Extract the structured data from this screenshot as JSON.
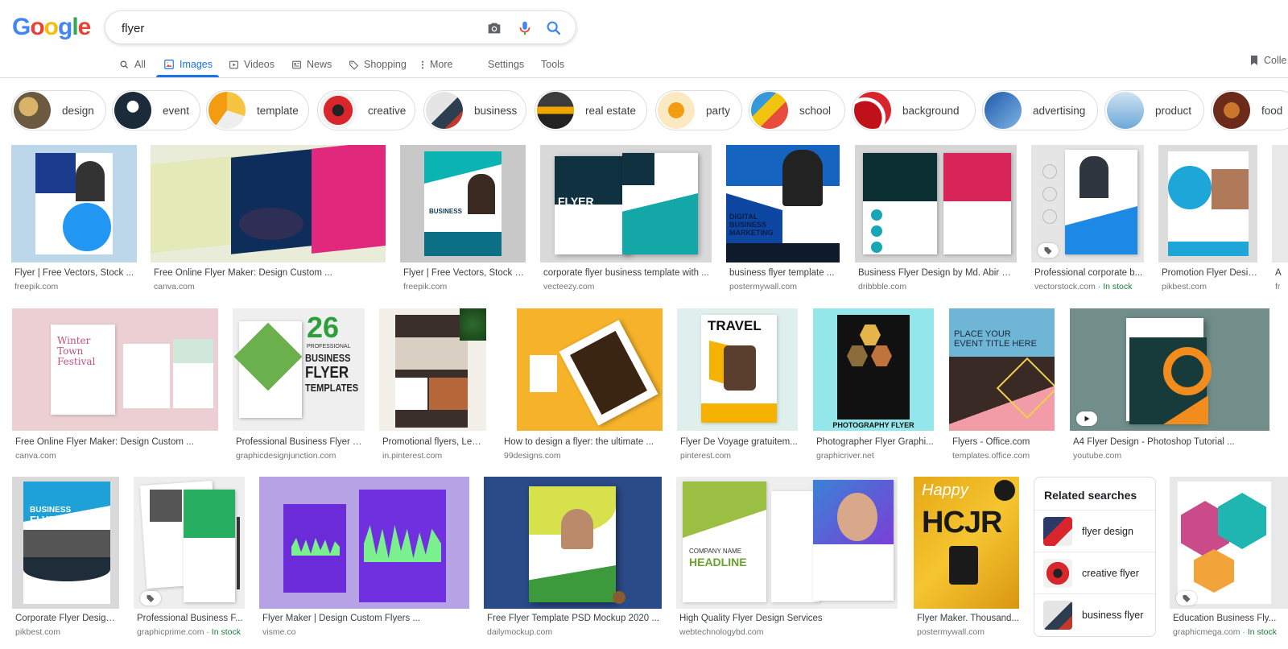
{
  "logo": {
    "letters": [
      "G",
      "o",
      "o",
      "g",
      "l",
      "e"
    ],
    "colors": [
      "#4285F4",
      "#EA4335",
      "#FBBC05",
      "#4285F4",
      "#34A853",
      "#EA4335"
    ]
  },
  "search": {
    "query": "flyer"
  },
  "nav": {
    "items": [
      "All",
      "Images",
      "Videos",
      "News",
      "Shopping",
      "More"
    ],
    "settings": "Settings",
    "tools": "Tools",
    "collections": "Colle"
  },
  "chips": [
    "design",
    "event",
    "template",
    "creative",
    "business",
    "real estate",
    "party",
    "school",
    "background",
    "advertising",
    "product",
    "food"
  ],
  "results": [
    {
      "title": "Flyer | Free Vectors, Stock ...",
      "source": "freepik.com",
      "stock": ""
    },
    {
      "title": "Free Online Flyer Maker: Design Custom ...",
      "source": "canva.com",
      "stock": ""
    },
    {
      "title": "Flyer | Free Vectors, Stock P...",
      "source": "freepik.com",
      "stock": ""
    },
    {
      "title": "corporate flyer business template with ...",
      "source": "vecteezy.com",
      "stock": ""
    },
    {
      "title": "business flyer template ...",
      "source": "postermywall.com",
      "stock": ""
    },
    {
      "title": "Business Flyer Design by Md. Abir H...",
      "source": "dribbble.com",
      "stock": ""
    },
    {
      "title": "Professional corporate b...",
      "source": "vectorstock.com",
      "stock": "In stock"
    },
    {
      "title": "Promotion Flyer Design...",
      "source": "pikbest.com",
      "stock": ""
    },
    {
      "title": "A",
      "source": "fr",
      "stock": ""
    },
    {
      "title": "Free Online Flyer Maker: Design Custom ...",
      "source": "canva.com",
      "stock": ""
    },
    {
      "title": "Professional Business Flyer T...",
      "source": "graphicdesignjunction.com",
      "stock": ""
    },
    {
      "title": "Promotional flyers, Lea...",
      "source": "in.pinterest.com",
      "stock": ""
    },
    {
      "title": "How to design a flyer: the ultimate ...",
      "source": "99designs.com",
      "stock": ""
    },
    {
      "title": "Flyer De Voyage gratuitem...",
      "source": "pinterest.com",
      "stock": ""
    },
    {
      "title": "Photographer Flyer Graphi...",
      "source": "graphicriver.net",
      "stock": ""
    },
    {
      "title": "Flyers - Office.com",
      "source": "templates.office.com",
      "stock": ""
    },
    {
      "title": "A4 Flyer Design - Photoshop Tutorial ...",
      "source": "youtube.com",
      "stock": ""
    },
    {
      "title": "Corporate Flyer Design ...",
      "source": "pikbest.com",
      "stock": ""
    },
    {
      "title": "Professional Business F...",
      "source": "graphicprime.com",
      "stock": "In stock"
    },
    {
      "title": "Flyer Maker | Design Custom Flyers ...",
      "source": "visme.co",
      "stock": ""
    },
    {
      "title": "Free Flyer Template PSD Mockup 2020 ...",
      "source": "dailymockup.com",
      "stock": ""
    },
    {
      "title": "High Quality Flyer Design Services",
      "source": "webtechnologybd.com",
      "stock": ""
    },
    {
      "title": "Flyer Maker. Thousand...",
      "source": "postermywall.com",
      "stock": ""
    },
    {
      "title": "Education Business Fly...",
      "source": "graphicmega.com",
      "stock": "In stock"
    }
  ],
  "image_text": {
    "r1_3": "BUSINESS",
    "r1_4": "FLYER",
    "r1_5a": "DIGITAL",
    "r1_5b": "BUSINESS",
    "r1_5c": "MARKETING",
    "r2_1a": "Winter",
    "r2_1b": "Town",
    "r2_1c": "Festival",
    "r2_2a": "26",
    "r2_2b": "PROFESSIONAL",
    "r2_2c": "BUSINESS",
    "r2_2d": "FLYER",
    "r2_2e": "TEMPLATES",
    "r2_5": "TRAVEL",
    "r2_6": "PHOTOGRAPHY FLYER",
    "r2_7a": "PLACE YOUR",
    "r2_7b": "EVENT TITLE HERE",
    "r3_1a": "BUSINESS",
    "r3_1b": "FLYER",
    "r3_5a": "COMPANY NAME",
    "r3_5b": "HEADLINE",
    "r3_6a": "Happy",
    "r3_6b": "HCJR"
  },
  "related": {
    "title": "Related searches",
    "items": [
      "flyer design",
      "creative flyer",
      "business flyer"
    ]
  }
}
